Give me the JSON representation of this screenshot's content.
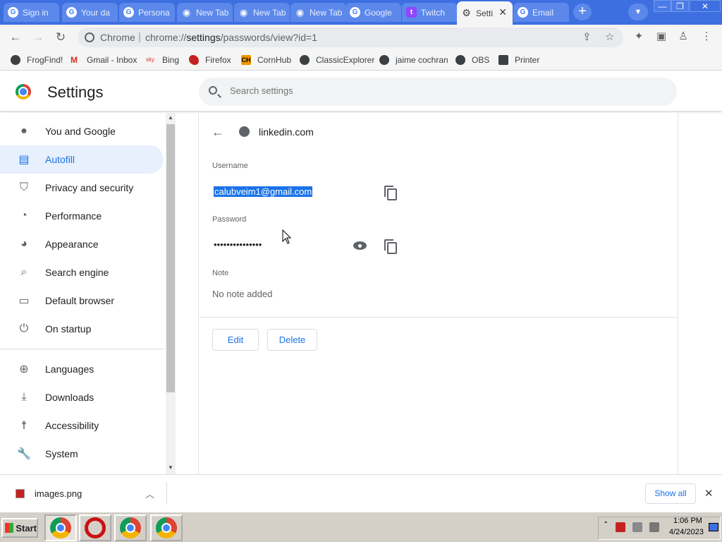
{
  "browser": {
    "tabs": [
      {
        "label": "Sign in",
        "icon": "google-icon"
      },
      {
        "label": "Your da",
        "icon": "google-icon"
      },
      {
        "label": "Persona",
        "icon": "google-icon"
      },
      {
        "label": "New Tab",
        "icon": "globe-icon"
      },
      {
        "label": "New Tab",
        "icon": "globe-icon"
      },
      {
        "label": "New Tab",
        "icon": "globe-icon"
      },
      {
        "label": "Google",
        "icon": "google-icon"
      },
      {
        "label": "Twitch",
        "icon": "twitch-icon"
      },
      {
        "label": "Setti",
        "icon": "gear-icon",
        "active": true
      },
      {
        "label": "Email",
        "icon": "google-icon"
      }
    ],
    "omnibox": {
      "site_label": "Chrome",
      "url_prefix": "chrome://",
      "url_host": "settings",
      "url_path": "/passwords/view?id=1"
    },
    "bookmarks": [
      {
        "label": "FrogFind!",
        "icon": "frogfind-icon"
      },
      {
        "label": "Gmail - Inbox",
        "icon": "gmail-icon"
      },
      {
        "label": "Bing",
        "icon": "bing-icon"
      },
      {
        "label": "Firefox",
        "icon": "firefox-icon"
      },
      {
        "label": "CornHub",
        "icon": "cornhub-icon",
        "badge": "CH"
      },
      {
        "label": "ClassicExplorer",
        "icon": "globe-icon"
      },
      {
        "label": "jaime cochran",
        "icon": "globe-icon"
      },
      {
        "label": "OBS",
        "icon": "globe-icon"
      },
      {
        "label": "Printer",
        "icon": "printer-icon"
      }
    ]
  },
  "settings": {
    "title": "Settings",
    "search_placeholder": "Search settings",
    "nav": [
      {
        "label": "You and Google",
        "icon": "person-icon"
      },
      {
        "label": "Autofill",
        "icon": "clipboard-icon",
        "active": true
      },
      {
        "label": "Privacy and security",
        "icon": "shield-icon"
      },
      {
        "label": "Performance",
        "icon": "speedometer-icon"
      },
      {
        "label": "Appearance",
        "icon": "palette-icon"
      },
      {
        "label": "Search engine",
        "icon": "search-icon"
      },
      {
        "label": "Default browser",
        "icon": "browser-icon"
      },
      {
        "label": "On startup",
        "icon": "power-icon"
      },
      {
        "label": "Languages",
        "icon": "globe-icon"
      },
      {
        "label": "Downloads",
        "icon": "download-icon"
      },
      {
        "label": "Accessibility",
        "icon": "accessibility-icon"
      },
      {
        "label": "System",
        "icon": "wrench-icon"
      }
    ],
    "password_detail": {
      "site": "linkedin.com",
      "username_label": "Username",
      "username_value": "calubveim1@gmail.com",
      "password_label": "Password",
      "password_value": "•••••••••••••••",
      "note_label": "Note",
      "note_value": "No note added",
      "edit_label": "Edit",
      "delete_label": "Delete"
    }
  },
  "download_shelf": {
    "filename": "images.png",
    "show_all_label": "Show all"
  },
  "taskbar": {
    "start_label": "Start",
    "time": "1:06 PM",
    "date": "4/24/2023"
  },
  "colors": {
    "tabstrip": "#3d6fe0",
    "accent": "#1a73e8",
    "active_nav_bg": "#e8f0fe"
  }
}
